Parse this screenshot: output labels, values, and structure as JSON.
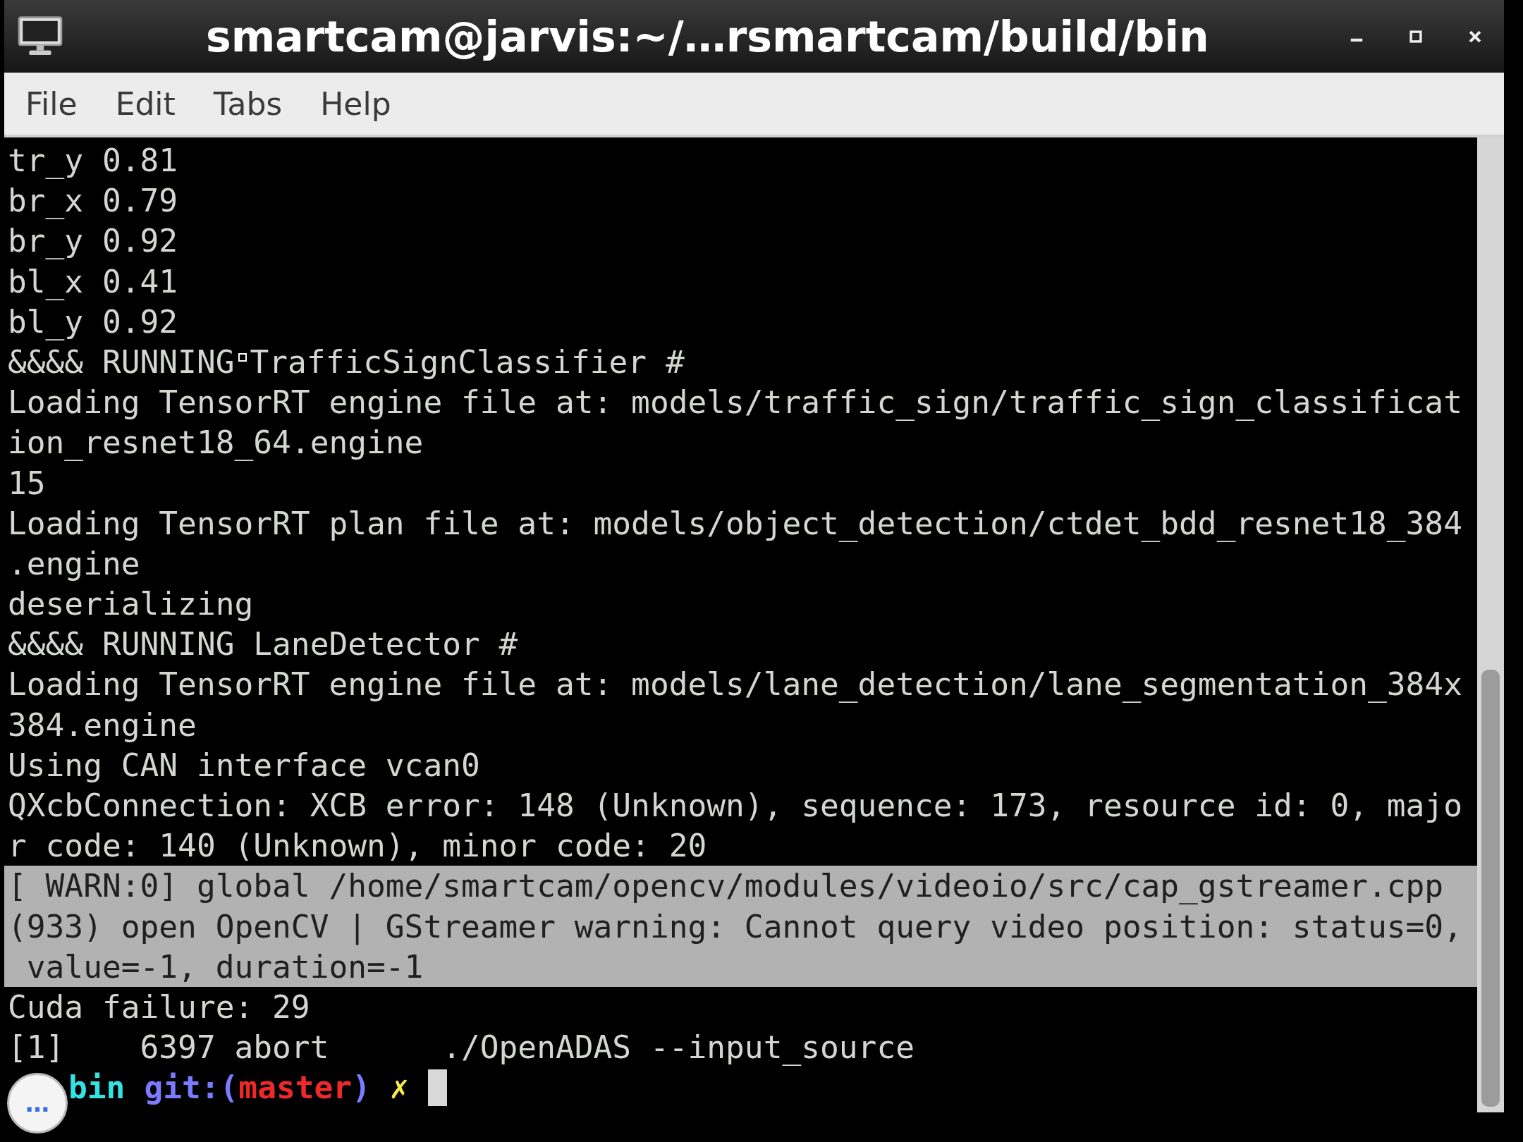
{
  "window": {
    "title": "smartcam@jarvis:~/…rsmartcam/build/bin"
  },
  "menu": [
    "File",
    "Edit",
    "Tabs",
    "Help"
  ],
  "terminal": {
    "lines": [
      {
        "parts": [
          "tr_y 0.81"
        ],
        "selected": false
      },
      {
        "parts": [
          "br_x 0.79"
        ],
        "selected": false
      },
      {
        "parts": [
          "br_y 0.92"
        ],
        "selected": false
      },
      {
        "parts": [
          "bl_x 0.41"
        ],
        "selected": false
      },
      {
        "parts": [
          "bl_y 0.92"
        ],
        "selected": false
      },
      {
        "parts": [
          "&&&& RUNNING",
          "TrafficSignClassifier #"
        ],
        "selected": false
      },
      {
        "parts": [
          "Loading TensorRT engine file at: models/traffic_sign/traffic_sign_classificat"
        ],
        "selected": false
      },
      {
        "parts": [
          "ion_resnet18_64.engine"
        ],
        "selected": false
      },
      {
        "parts": [
          "15"
        ],
        "selected": false
      },
      {
        "parts": [
          "Loading TensorRT plan file at: models/object_detection/ctdet_bdd_resnet18_384"
        ],
        "selected": false
      },
      {
        "parts": [
          ".engine"
        ],
        "selected": false
      },
      {
        "parts": [
          "deserializing"
        ],
        "selected": false
      },
      {
        "parts": [
          "&&&& RUNNING LaneDetector #"
        ],
        "selected": false
      },
      {
        "parts": [
          "Loading TensorRT engine file at: models/lane_detection/lane_segmentation_384x"
        ],
        "selected": false
      },
      {
        "parts": [
          "384.engine"
        ],
        "selected": false
      },
      {
        "parts": [
          "Using CAN interface vcan0"
        ],
        "selected": false
      },
      {
        "parts": [
          "QXcbConnection: XCB error: 148 (Unknown), sequence: 173, resource id: 0, majo"
        ],
        "selected": false
      },
      {
        "parts": [
          "r code: 140 (Unknown), minor code: 20"
        ],
        "selected": false
      },
      {
        "parts": [
          "[ WARN:0] global /home/smartcam/opencv/modules/videoio/src/cap_gstreamer.cpp"
        ],
        "selected": true
      },
      {
        "parts": [
          "(933) open OpenCV | GStreamer warning: Cannot query video position: status=0,"
        ],
        "selected": true
      },
      {
        "parts": [
          " value=-1, duration=-1"
        ],
        "selected": true
      },
      {
        "parts": [
          "Cuda failure: 29"
        ],
        "selected": false
      },
      {
        "parts": [
          "[1]    6397 abort      ./OpenADAS --input_source"
        ],
        "selected": false
      }
    ],
    "prompt": [
      {
        "text": "bin",
        "color": "#34e2e2"
      },
      {
        "text": "git:(",
        "color": "#7b7bff"
      },
      {
        "text": "master",
        "color": "#ef2929"
      },
      {
        "text": ")",
        "color": "#7b7bff"
      },
      {
        "text": "✗",
        "color": "#fce94f"
      }
    ]
  },
  "overlay_button": {
    "label": "…"
  }
}
